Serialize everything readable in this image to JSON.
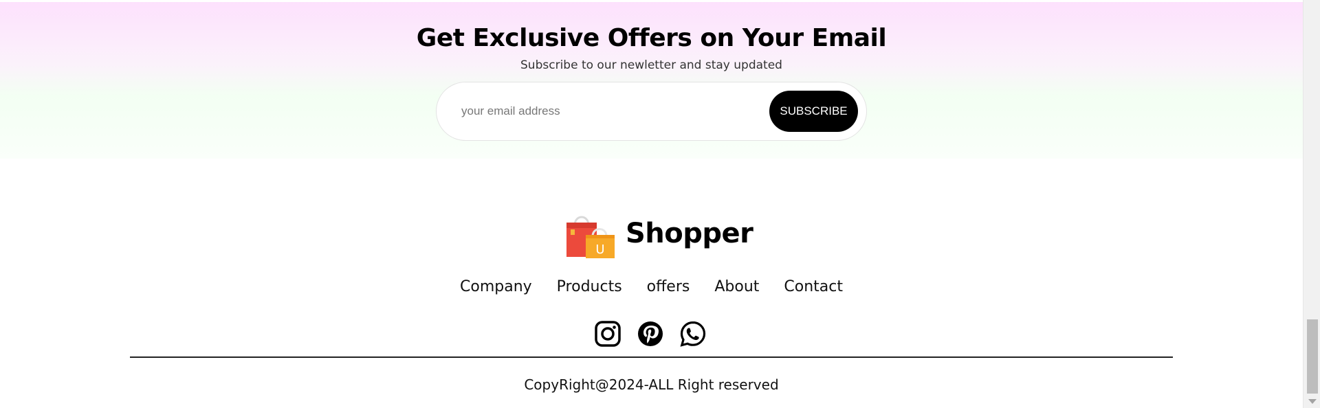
{
  "newsletter": {
    "title": "Get Exclusive Offers on Your Email",
    "subtitle": "Subscribe to our newletter and stay updated",
    "email_placeholder": "your email address",
    "email_value": "",
    "button_label": "SUBSCRIBE"
  },
  "brand": {
    "name": "Shopper",
    "logo_icon": "shopping-bags-icon",
    "logo_letter": "U"
  },
  "footer": {
    "links": [
      "Company",
      "Products",
      "offers",
      "About",
      "Contact"
    ],
    "social_icons": [
      "instagram-icon",
      "pinterest-icon",
      "whatsapp-icon"
    ],
    "copyright": "CopyRight@2024-ALL Right reserved"
  },
  "colors": {
    "button_bg": "#000000",
    "bag_red": "#ec4a3c",
    "bag_orange": "#f7a928"
  }
}
